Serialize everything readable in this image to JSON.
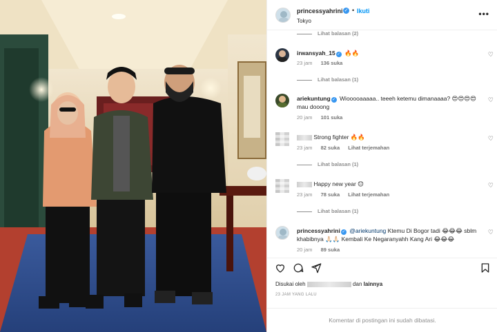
{
  "header": {
    "username": "princessyahrini",
    "follow_label": "Ikuti",
    "location": "Tokyo",
    "dot": "•",
    "more_icon": "more-horizontal-icon",
    "verified": "✓"
  },
  "comments": [
    {
      "reply_label": "Lihat balasan (2)"
    },
    {
      "username": "irwansyah_15",
      "text": "🔥🔥",
      "time": "23 jam",
      "likes": "136 suka",
      "reply_label": "Lihat balasan (1)"
    },
    {
      "username": "ariekuntung",
      "text": "Wiooooaaaaa.. teeeh ketemu dimanaaaa? 😍😍😍😍 mau dooong",
      "time": "20 jam",
      "likes": "101 suka"
    },
    {
      "username": "",
      "text": "Strong fighter 🔥🔥",
      "time": "23 jam",
      "likes": "82 suka",
      "translate": "Lihat terjemahan",
      "reply_label": "Lihat balasan (1)"
    },
    {
      "username": "",
      "text": "Happy new year 😊",
      "time": "23 jam",
      "likes": "78 suka",
      "translate": "Lihat terjemahan",
      "reply_label": "Lihat balasan (1)"
    },
    {
      "username": "princessyahrini",
      "mention": "@ariekuntung",
      "text": "Ktemu Di Bogor tadi 😂😂😂 sblm khabibnya 🙏🏻🙏🏻 Kembali Ke Negaranyahh Kang Ari 😂😂😂",
      "time": "20 jam",
      "likes": "89 suka"
    }
  ],
  "likes": {
    "prefix": "Disukai oleh",
    "middle": "dan",
    "suffix": "lainnya"
  },
  "timestamp": "23 JAM YANG LALU",
  "comments_disabled": "Komentar di postingan ini sudah dibatasi.",
  "icons": {
    "like": "heart-icon",
    "comment": "comment-icon",
    "share": "share-icon",
    "save": "bookmark-icon"
  }
}
